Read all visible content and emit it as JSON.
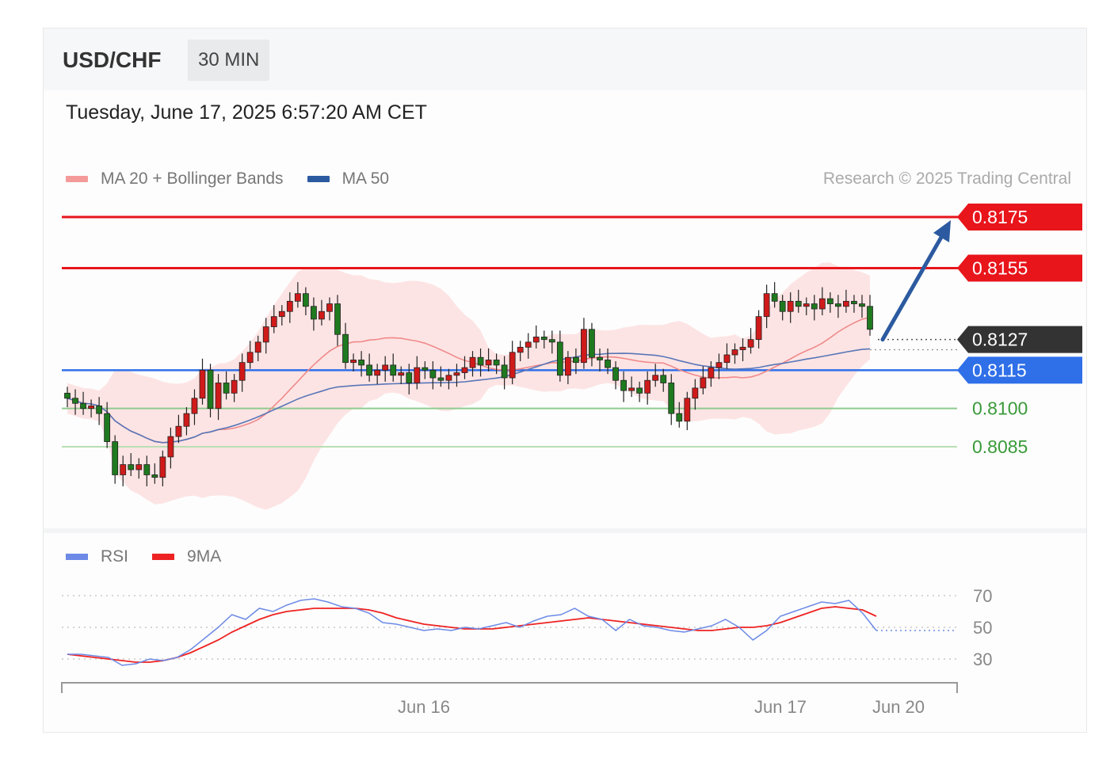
{
  "header": {
    "symbol": "USD/CHF",
    "timeframe": "30 MIN"
  },
  "timestamp": "Tuesday, June 17, 2025 6:57:20 AM CET",
  "legend": {
    "ma20": {
      "label": "MA 20 + Bollinger Bands",
      "color": "#f59a9a"
    },
    "ma50": {
      "label": "MA 50",
      "color": "#2c5aa0"
    }
  },
  "credit": "Research © 2025 Trading Central",
  "rsi_legend": {
    "rsi": {
      "label": "RSI",
      "color": "#6d8ae6"
    },
    "ma9": {
      "label": "9MA",
      "color": "#ee2222"
    }
  },
  "chart_data": [
    {
      "type": "candlestick",
      "title": "USD/CHF 30 MIN",
      "ylim": [
        0.8063,
        0.8182
      ],
      "x_ticks": [
        "Jun 16",
        "Jun 17",
        "Jun 20"
      ],
      "price_levels": [
        {
          "label": "0.8175",
          "value": 0.8175,
          "kind": "resistance",
          "color": "#e8151b"
        },
        {
          "label": "0.8155",
          "value": 0.8155,
          "kind": "resistance",
          "color": "#e8151b"
        },
        {
          "label": "0.8127",
          "value": 0.8127,
          "kind": "last price",
          "color": "#333333"
        },
        {
          "label": "0.8115",
          "value": 0.8115,
          "kind": "pivot",
          "color": "#2f6fe8"
        },
        {
          "label": "0.8100",
          "value": 0.81,
          "kind": "support",
          "color": "#3a9a3a"
        },
        {
          "label": "0.8085",
          "value": 0.8085,
          "kind": "support",
          "color": "#3a9a3a"
        }
      ],
      "target_arrow": {
        "from": 0.8127,
        "to": 0.8175
      },
      "closes": [
        0.8104,
        0.8102,
        0.81,
        0.8101,
        0.8098,
        0.8087,
        0.8074,
        0.8078,
        0.8076,
        0.8078,
        0.8074,
        0.8073,
        0.8081,
        0.8089,
        0.8093,
        0.8098,
        0.8104,
        0.8115,
        0.81,
        0.811,
        0.8106,
        0.8111,
        0.8118,
        0.8122,
        0.8126,
        0.8132,
        0.8136,
        0.8138,
        0.8142,
        0.8145,
        0.814,
        0.8135,
        0.8138,
        0.8141,
        0.8129,
        0.8118,
        0.8119,
        0.8117,
        0.8113,
        0.8115,
        0.8117,
        0.8113,
        0.8114,
        0.811,
        0.8116,
        0.8115,
        0.8112,
        0.8111,
        0.8113,
        0.8114,
        0.8116,
        0.812,
        0.8117,
        0.8119,
        0.8117,
        0.8112,
        0.8122,
        0.8124,
        0.8126,
        0.8128,
        0.8127,
        0.8126,
        0.8113,
        0.812,
        0.8118,
        0.8131,
        0.812,
        0.8119,
        0.8116,
        0.8111,
        0.8107,
        0.8108,
        0.8106,
        0.8111,
        0.8113,
        0.811,
        0.8098,
        0.8095,
        0.8104,
        0.8108,
        0.8112,
        0.8116,
        0.8118,
        0.8121,
        0.8123,
        0.8124,
        0.8127,
        0.8136,
        0.8145,
        0.8142,
        0.8138,
        0.8142,
        0.814,
        0.8141,
        0.8139,
        0.8143,
        0.8141,
        0.814,
        0.8142,
        0.8141,
        0.814,
        0.8131
      ]
    },
    {
      "type": "line",
      "title": "RSI",
      "ylim": [
        20,
        80
      ],
      "y_ticks": [
        "70",
        "50",
        "30"
      ],
      "series": [
        {
          "name": "RSI",
          "values": [
            33,
            33,
            32,
            31,
            26,
            27,
            30,
            29,
            31,
            36,
            43,
            50,
            58,
            55,
            62,
            60,
            64,
            67,
            68,
            66,
            63,
            62,
            59,
            53,
            52,
            50,
            48,
            49,
            48,
            50,
            49,
            51,
            53,
            50,
            54,
            57,
            58,
            62,
            57,
            55,
            48,
            55,
            51,
            50,
            48,
            47,
            49,
            51,
            55,
            50,
            42,
            48,
            57,
            60,
            63,
            66,
            65,
            67,
            59,
            48
          ]
        },
        {
          "name": "9MA",
          "values": [
            33,
            32,
            31,
            30,
            29,
            28,
            28,
            29,
            31,
            34,
            38,
            42,
            47,
            51,
            55,
            58,
            60,
            61,
            62,
            62,
            62,
            62,
            61,
            59,
            56,
            54,
            52,
            51,
            50,
            49,
            49,
            49,
            50,
            51,
            52,
            53,
            54,
            55,
            56,
            55,
            54,
            53,
            52,
            51,
            50,
            49,
            48,
            48,
            49,
            50,
            50,
            51,
            53,
            56,
            59,
            62,
            63,
            62,
            61,
            57
          ]
        }
      ]
    }
  ]
}
